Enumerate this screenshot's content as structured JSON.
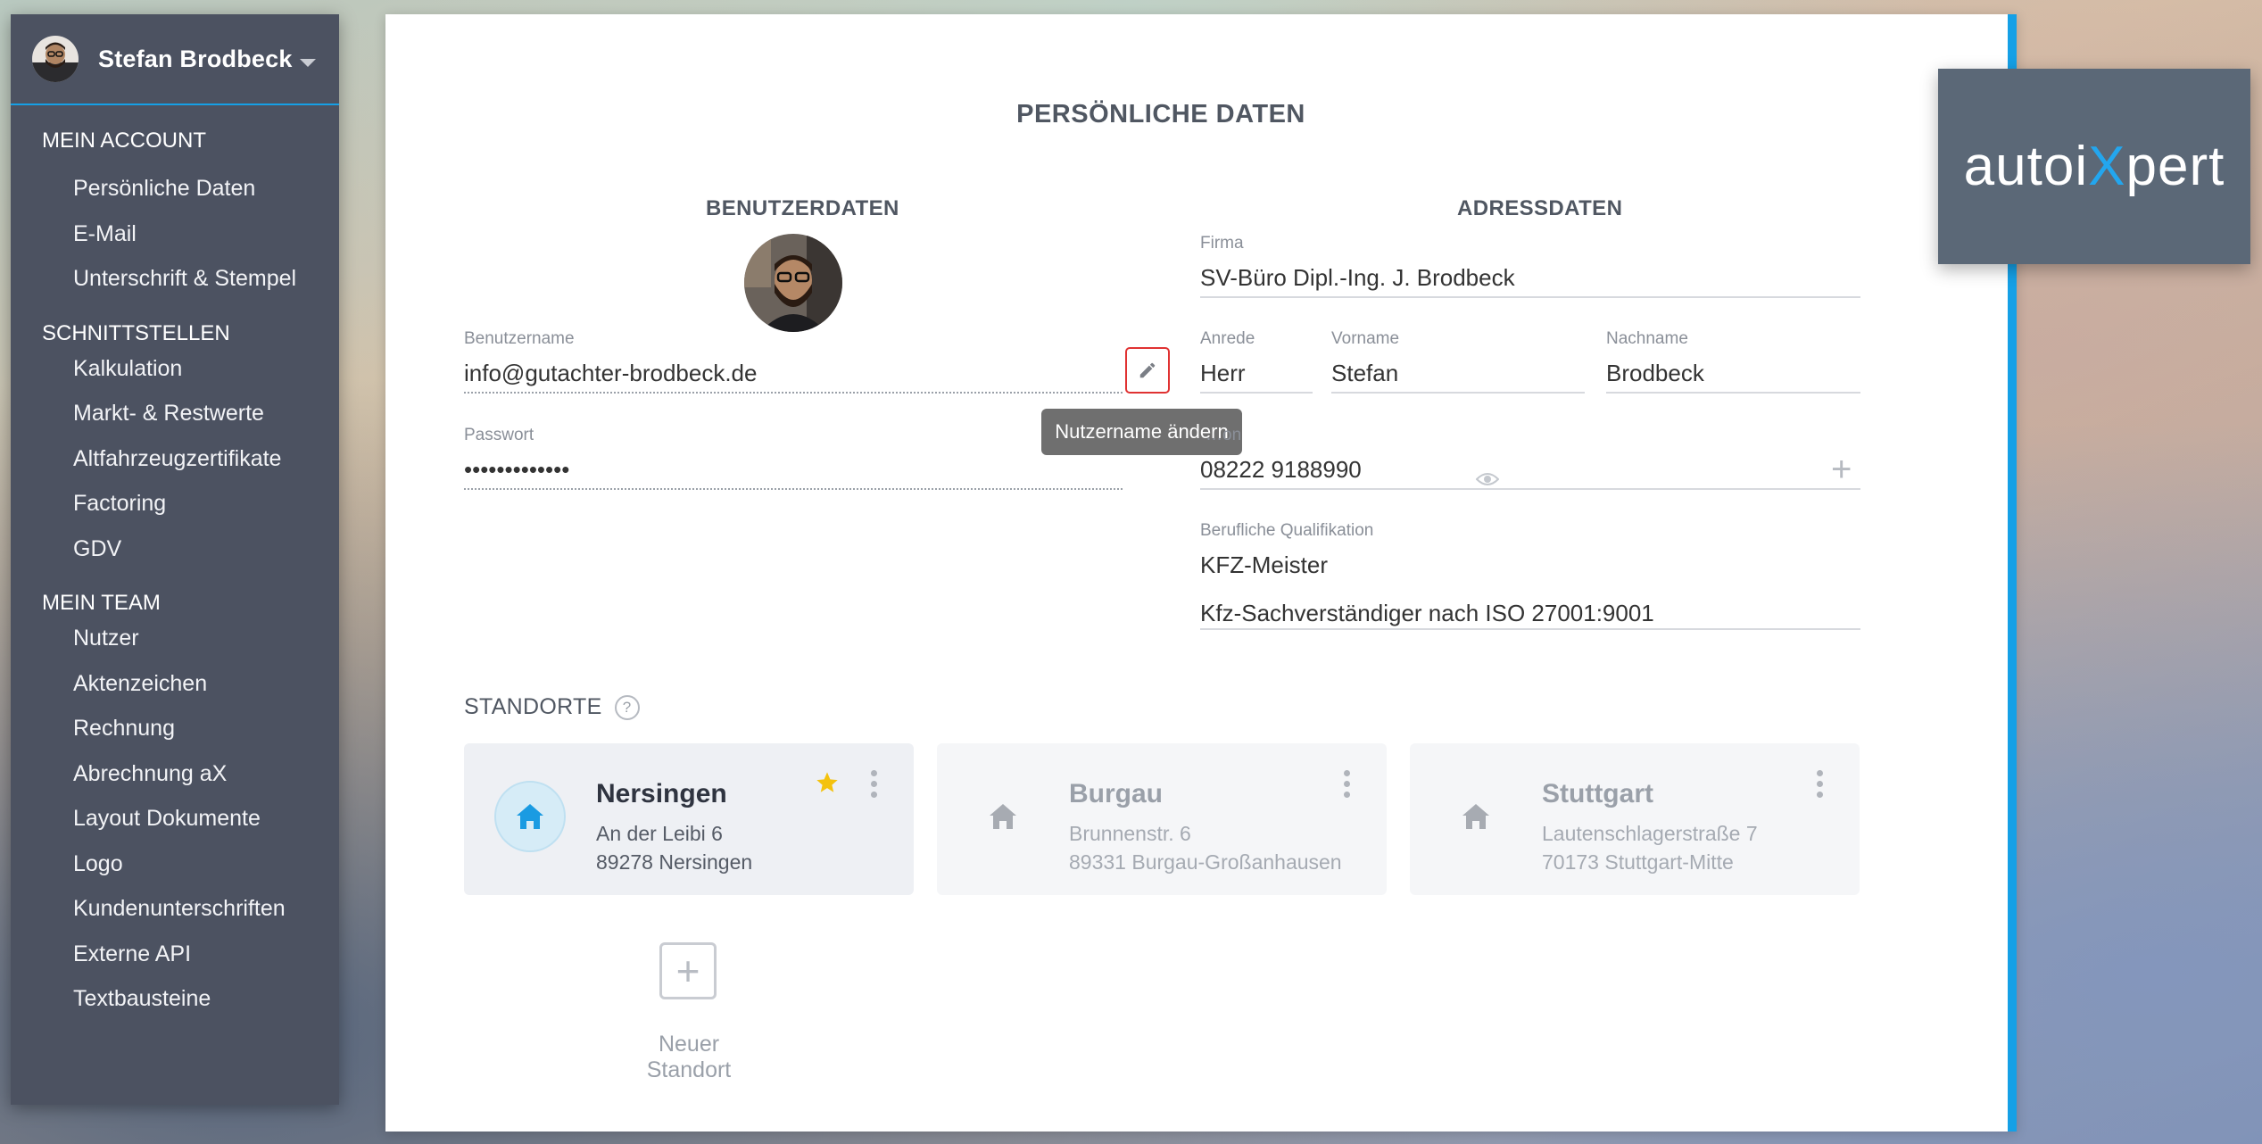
{
  "user": {
    "name": "Stefan Brodbeck"
  },
  "sidebar": {
    "sections": [
      {
        "title": "MEIN ACCOUNT",
        "items": [
          "Persönliche Daten",
          "E-Mail",
          "Unterschrift & Stempel"
        ]
      },
      {
        "title": "SCHNITTSTELLEN",
        "items": [
          "Kalkulation",
          "Markt- & Restwerte",
          "Altfahrzeugzertifikate",
          "Factoring",
          "GDV"
        ]
      },
      {
        "title": "MEIN TEAM",
        "items": [
          "Nutzer",
          "Aktenzeichen",
          "Rechnung",
          "Abrechnung aX",
          "Layout Dokumente",
          "Logo",
          "Kundenunterschriften",
          "Externe API",
          "Textbausteine"
        ]
      }
    ]
  },
  "page": {
    "title": "PERSÖNLICHE DATEN",
    "benutzerdaten_title": "BENUTZERDATEN",
    "adressdaten_title": "ADRESSDATEN"
  },
  "benutzer": {
    "username_label": "Benutzername",
    "username_value": "info@gutachter-brodbeck.de",
    "password_label": "Passwort",
    "password_value": "•••••••••••••",
    "edit_tooltip": "Nutzername ändern"
  },
  "adresse": {
    "firma_label": "Firma",
    "firma_value": "SV-Büro Dipl.-Ing. J. Brodbeck",
    "anrede_label": "Anrede",
    "anrede_value": "Herr",
    "vorname_label": "Vorname",
    "vorname_value": "Stefan",
    "nachname_label": "Nachname",
    "nachname_value": "Brodbeck",
    "telefon_label": "…on",
    "telefon_value": "08222 9188990",
    "qualifikation_label": "Berufliche Qualifikation",
    "qualifikation_1": "KFZ-Meister",
    "qualifikation_2": "Kfz-Sachverständiger nach ISO 27001:9001"
  },
  "standorte": {
    "title": "STANDORTE",
    "help": "?",
    "locations": [
      {
        "name": "Nersingen",
        "street": "An der Leibi 6",
        "city": "89278 Nersingen",
        "favorite": true,
        "active": true
      },
      {
        "name": "Burgau",
        "street": "Brunnenstr. 6",
        "city": "89331 Burgau-Großanhausen",
        "favorite": false,
        "active": false
      },
      {
        "name": "Stuttgart",
        "street": "Lautenschlagerstraße 7",
        "city": "70173 Stuttgart-Mitte",
        "favorite": false,
        "active": false
      }
    ],
    "new_label": "Neuer Standort",
    "new_icon": "+"
  },
  "logo": {
    "part1": "autoi",
    "part2": "X",
    "part3": "pert"
  },
  "colors": {
    "accent": "#15a0e6",
    "sidebar": "#4c5261",
    "star": "#f4c20d",
    "edit_highlight": "#e03232"
  }
}
